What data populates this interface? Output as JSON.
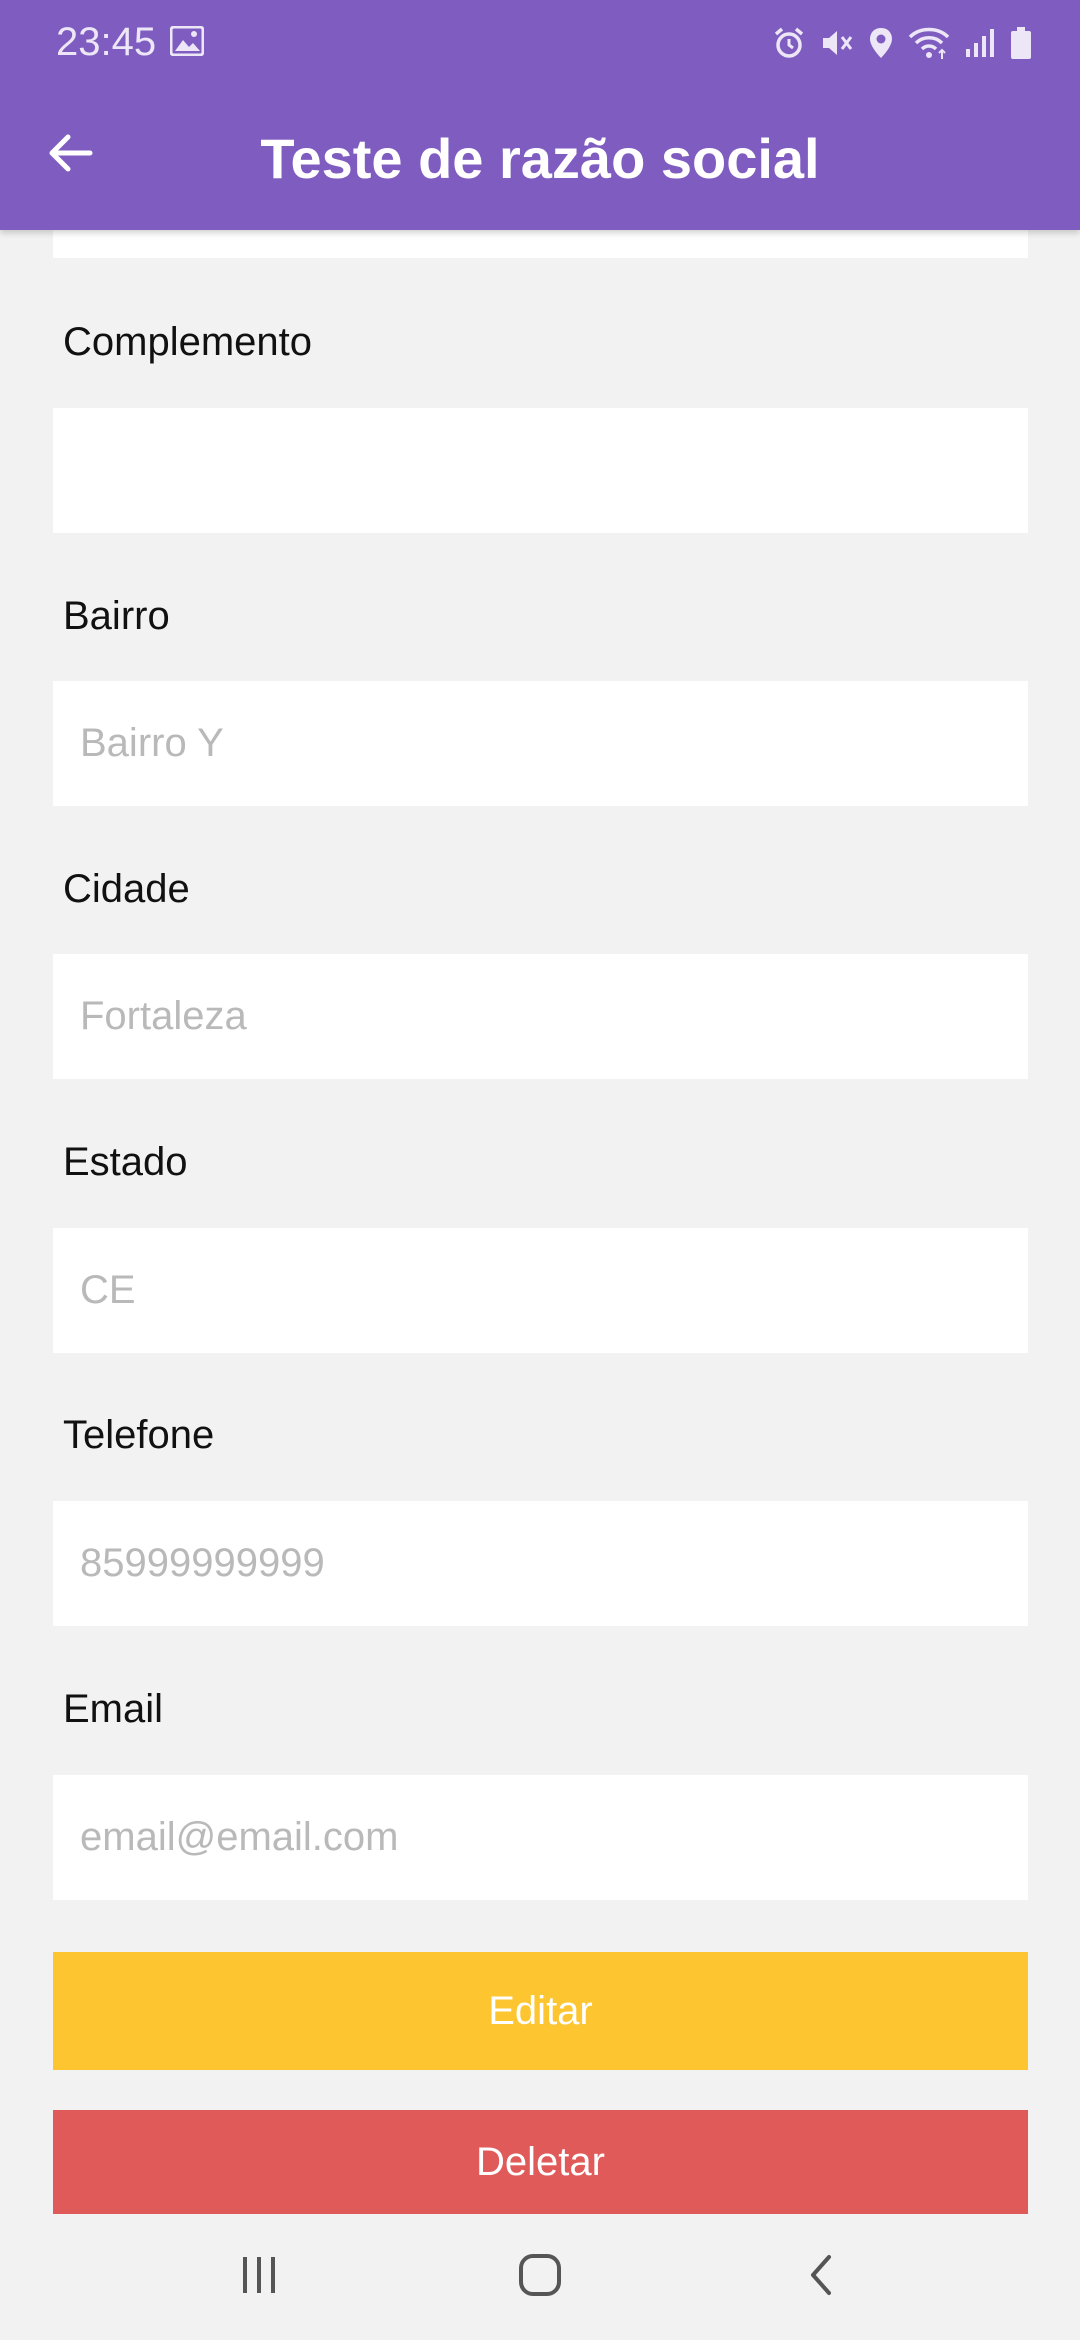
{
  "status_bar": {
    "time": "23:45",
    "icons": [
      "gallery-icon",
      "alarm-icon",
      "mute-icon",
      "location-icon",
      "wifi-icon",
      "signal-icon",
      "battery-icon"
    ]
  },
  "toolbar": {
    "back_icon": "arrow-left-icon",
    "title": "Teste de razão social"
  },
  "form": {
    "complemento": {
      "label": "Complemento",
      "placeholder": ""
    },
    "bairro": {
      "label": "Bairro",
      "placeholder": "Bairro Y"
    },
    "cidade": {
      "label": "Cidade",
      "placeholder": "Fortaleza"
    },
    "estado": {
      "label": "Estado",
      "placeholder": "CE"
    },
    "telefone": {
      "label": "Telefone",
      "placeholder": "85999999999"
    },
    "email": {
      "label": "Email",
      "placeholder": "email@email.com"
    }
  },
  "actions": {
    "edit_label": "Editar",
    "delete_label": "Deletar"
  },
  "colors": {
    "app_bar": "#7f5dc0",
    "edit_button": "#fdc530",
    "delete_button": "#e05a5a",
    "background": "#f2f2f2"
  },
  "nav_bar": {
    "icons": [
      "recent-apps-icon",
      "home-icon",
      "back-nav-icon"
    ]
  }
}
